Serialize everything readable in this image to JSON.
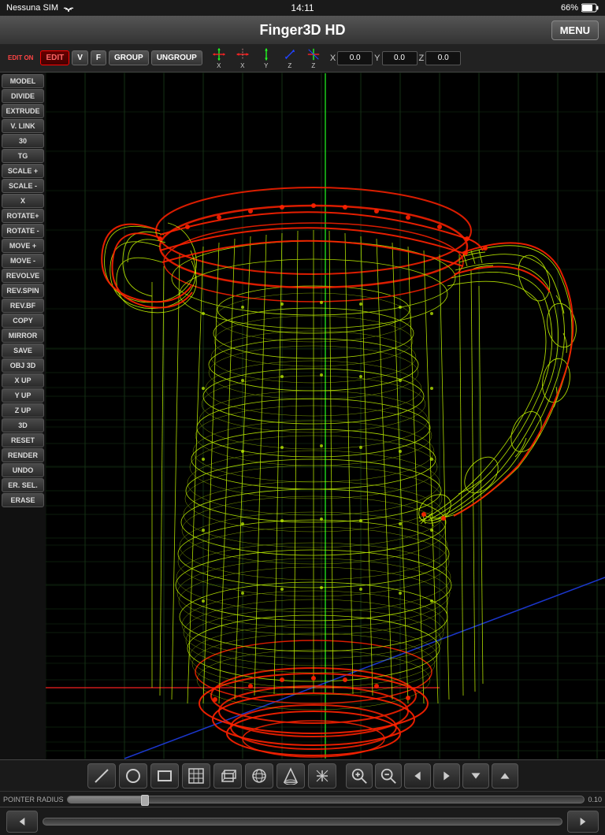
{
  "statusBar": {
    "carrier": "Nessuna SIM",
    "time": "14:11",
    "battery": "66%"
  },
  "titleBar": {
    "title": "Finger3D HD",
    "menuLabel": "MENU"
  },
  "toolbar": {
    "editOn": "EDIT ON",
    "editLabel": "EDIT",
    "vLabel": "V",
    "fLabel": "F",
    "groupLabel": "GROUP",
    "ungroupLabel": "UNGROUP",
    "xCoordLabel": "X",
    "yCoordLabel": "Y",
    "zCoordLabel": "Z",
    "xValue": "0.0",
    "yValue": "0.0",
    "zValue": "0.0"
  },
  "sidebar": {
    "buttons": [
      {
        "label": "MODEL",
        "active": false
      },
      {
        "label": "DIVIDE",
        "active": false
      },
      {
        "label": "EXTRUDE",
        "active": false
      },
      {
        "label": "V. LINK",
        "active": false
      },
      {
        "label": "30",
        "active": false
      },
      {
        "label": "TG",
        "active": false
      },
      {
        "label": "SCALE +",
        "active": false
      },
      {
        "label": "SCALE -",
        "active": false
      },
      {
        "label": "X",
        "active": false
      },
      {
        "label": "ROTATE+",
        "active": false
      },
      {
        "label": "ROTATE -",
        "active": false
      },
      {
        "label": "MOVE +",
        "active": false
      },
      {
        "label": "MOVE -",
        "active": false
      },
      {
        "label": "REVOLVE",
        "active": false
      },
      {
        "label": "REV.SPIN",
        "active": false
      },
      {
        "label": "REV.BF",
        "active": false
      },
      {
        "label": "COPY",
        "active": false
      },
      {
        "label": "MIRROR",
        "active": false
      },
      {
        "label": "SAVE",
        "active": false
      },
      {
        "label": "OBJ 3D",
        "active": false
      },
      {
        "label": "X UP",
        "active": false
      },
      {
        "label": "Y UP",
        "active": false
      },
      {
        "label": "Z UP",
        "active": false
      },
      {
        "label": "3D",
        "active": false
      },
      {
        "label": "RESET",
        "active": false
      },
      {
        "label": "RENDER",
        "active": false
      },
      {
        "label": "UNDO",
        "active": false
      },
      {
        "label": "ER. SEL.",
        "active": false
      },
      {
        "label": "ERASE",
        "active": false
      }
    ]
  },
  "bottomToolbar": {
    "shapes": [
      "line",
      "circle",
      "rectangle",
      "grid",
      "box",
      "sphere",
      "cone",
      "crosshair"
    ],
    "zoomIn": "+",
    "zoomOut": "-",
    "arrowLeft": "←",
    "arrowRight": "→",
    "arrowDown": "↓",
    "arrowUp": "↑"
  },
  "sliderBar": {
    "label": "POINTER RADIUS",
    "value": "0.10"
  },
  "navBar": {
    "backLabel": "◀",
    "forwardLabel": "▶"
  },
  "colors": {
    "wireframe": "#ccff00",
    "selected": "#ff2200",
    "accent": "#ff4400",
    "grid": "#1a3a1a",
    "axisX": "#ff2222",
    "axisY": "#22ff22",
    "axisZ": "#2222ff"
  }
}
